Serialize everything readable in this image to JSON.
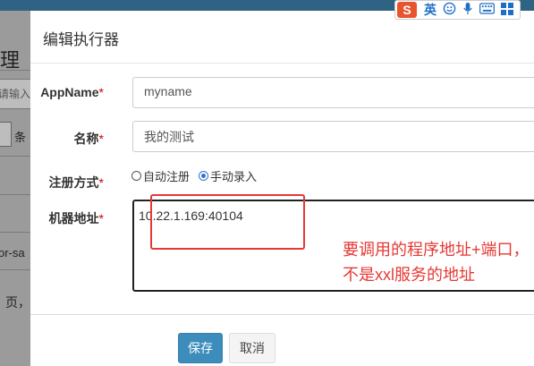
{
  "background": {
    "heading_char": "理",
    "input_placeholder": "请输入",
    "select_text": "条",
    "row_text": "or-sa",
    "page_text": "页，"
  },
  "ime": {
    "logo": "S",
    "lang": "英",
    "icons": [
      "smiley-icon",
      "microphone-icon",
      "keyboard-icon",
      "grid-icon"
    ]
  },
  "modal": {
    "title": "编辑执行器",
    "fields": {
      "appname": {
        "label": "AppName",
        "required": "*",
        "value": "myname"
      },
      "name": {
        "label": "名称",
        "required": "*",
        "value": "我的测试"
      },
      "register_type": {
        "label": "注册方式",
        "required": "*",
        "options": [
          "自动注册",
          "手动录入"
        ],
        "selected": "手动录入"
      },
      "address": {
        "label": "机器地址",
        "required": "*",
        "value": "10.22.1.169:40104"
      }
    },
    "annotation": "要调用的程序地址+端口，不是xxl服务的地址",
    "buttons": {
      "save": "保存",
      "cancel": "取消"
    }
  },
  "colors": {
    "accent": "#3c8dbc",
    "annotation": "#e53935",
    "header_bar": "#2e6384"
  }
}
